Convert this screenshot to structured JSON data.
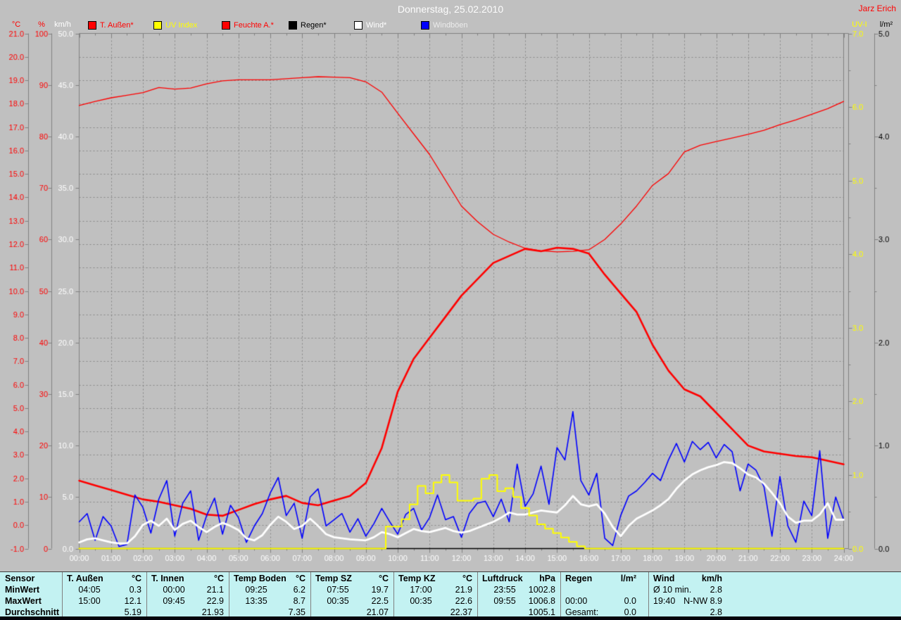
{
  "header": {
    "title": "Donnerstag, 25.02.2010",
    "watermark": "Jarz Erich"
  },
  "colors": {
    "background": "#c0c0c0",
    "grid": "#868686",
    "axis_line": "#808080",
    "title_text": "#fcfcfc",
    "watermark_text": "#ff0000",
    "x_label_text": "#ffffff",
    "table_background": "#c3f2f2",
    "table_text": "#000000",
    "bottom_strip": "#05050d"
  },
  "legend": [
    {
      "label": "T. Außen*",
      "swatch": "#ff0000",
      "text_color": "#ff0000"
    },
    {
      "label": "UV Index",
      "swatch": "#ffff00",
      "text_color": "#ffff00"
    },
    {
      "label": "Feuchte A.*",
      "swatch": "#ff0000",
      "text_color": "#ff0000"
    },
    {
      "label": "Regen*",
      "swatch": "#000000",
      "text_color": "#000000"
    },
    {
      "label": "Wind*",
      "swatch": "#ffffff",
      "text_color": "#ffffff"
    },
    {
      "label": "Windböen",
      "swatch": "#0000ff",
      "text_color": "#ececec"
    }
  ],
  "axes": {
    "left": [
      {
        "id": "degC",
        "header": "°C",
        "color": "#ff0000",
        "min": -1,
        "max": 21,
        "tick_step": 1,
        "decimals": 1
      },
      {
        "id": "pct",
        "header": "%",
        "color": "#ff0000",
        "min": 0,
        "max": 100,
        "tick_step": 10,
        "decimals": 0
      },
      {
        "id": "kmh",
        "header": "km/h",
        "color": "#ffffff",
        "min": 0,
        "max": 50,
        "tick_step": 5,
        "decimals": 1
      }
    ],
    "right": [
      {
        "id": "uvi",
        "header": "UV-I",
        "color": "#ffff00",
        "min": 0,
        "max": 7,
        "tick_step": 1,
        "decimals": 1
      },
      {
        "id": "lm2",
        "header": "l/m²",
        "color": "#000000",
        "min": 0,
        "max": 5,
        "tick_step": 1,
        "decimals": 1
      }
    ],
    "x_labels": [
      "00:00",
      "01:00",
      "02:00",
      "03:00",
      "04:00",
      "05:00",
      "06:00",
      "07:00",
      "08:00",
      "09:00",
      "10:00",
      "11:00",
      "12:00",
      "13:00",
      "14:00",
      "15:00",
      "16:00",
      "17:00",
      "18:00",
      "19:00",
      "20:00",
      "21:00",
      "22:00",
      "23:00",
      "24:00"
    ]
  },
  "chart_data": {
    "type": "line",
    "title": "Donnerstag, 25.02.2010",
    "x_unit": "hours",
    "x_range": [
      0,
      24
    ],
    "grid": "dashed, 1h vertical / 1°C horizontal",
    "legend_position": "top",
    "series": [
      {
        "name": "Feuchte A.*",
        "axis": "pct",
        "color": "#ff0000",
        "width": 1.3,
        "step_min": 30,
        "render": "line",
        "values": [
          86.0,
          86.8,
          87.5,
          88.0,
          88.5,
          89.5,
          89.2,
          89.4,
          90.2,
          90.8,
          91.0,
          91.0,
          91.0,
          91.2,
          91.4,
          91.6,
          91.5,
          91.4,
          90.6,
          88.6,
          84.5,
          80.5,
          76.5,
          71.5,
          66.5,
          63.5,
          61.0,
          59.5,
          58.3,
          57.8,
          57.6,
          57.7,
          58.0,
          60.0,
          63.0,
          66.5,
          70.5,
          72.8,
          77.0,
          78.3,
          79.0,
          79.7,
          80.4,
          81.2,
          82.3,
          83.2,
          84.3,
          85.4,
          86.8
        ]
      },
      {
        "name": "T. Außen*",
        "axis": "degC",
        "color": "#ff0000",
        "width": 2.6,
        "step_min": 30,
        "render": "line",
        "values": [
          1.9,
          1.7,
          1.5,
          1.3,
          1.1,
          1.0,
          0.85,
          0.7,
          0.45,
          0.4,
          0.65,
          0.9,
          1.1,
          1.25,
          0.95,
          0.85,
          1.05,
          1.25,
          1.8,
          3.3,
          5.7,
          7.1,
          8.0,
          8.9,
          9.8,
          10.5,
          11.2,
          11.5,
          11.8,
          11.7,
          11.85,
          11.8,
          11.6,
          10.7,
          9.9,
          9.1,
          7.7,
          6.6,
          5.8,
          5.5,
          4.8,
          4.1,
          3.4,
          3.15,
          3.05,
          2.95,
          2.9,
          2.75,
          2.6
        ]
      },
      {
        "name": "Regen*",
        "axis": "lm2",
        "color": "#000000",
        "width": 1.3,
        "step_min": 720,
        "render": "line",
        "values": [
          0,
          0,
          0
        ]
      },
      {
        "name": "Windböen",
        "axis": "kmh",
        "color": "#0000ff",
        "width": 1.6,
        "step_min": 15,
        "render": "line",
        "values": [
          2.6,
          3.4,
          0.8,
          3.1,
          2.2,
          0.2,
          0.4,
          5.2,
          4.0,
          1.5,
          4.8,
          6.6,
          1.2,
          4.4,
          5.6,
          0.8,
          3.2,
          4.9,
          1.4,
          4.2,
          3.0,
          0.6,
          2.2,
          3.4,
          5.4,
          6.9,
          3.2,
          4.4,
          1.0,
          5.0,
          5.8,
          2.2,
          2.8,
          3.4,
          1.6,
          2.9,
          1.2,
          2.4,
          3.9,
          2.6,
          1.4,
          3.3,
          3.9,
          1.8,
          3.0,
          5.2,
          2.8,
          3.1,
          1.1,
          3.4,
          4.4,
          4.6,
          3.1,
          4.8,
          2.6,
          8.2,
          4.1,
          5.3,
          8.0,
          4.3,
          9.8,
          8.6,
          13.3,
          6.6,
          5.2,
          7.3,
          1.0,
          0.3,
          3.2,
          5.1,
          5.6,
          6.4,
          7.3,
          6.6,
          8.6,
          10.2,
          8.4,
          10.4,
          9.6,
          10.3,
          8.8,
          10.1,
          9.4,
          5.6,
          8.2,
          7.6,
          6.0,
          1.2,
          7.0,
          2.2,
          0.6,
          4.6,
          3.2,
          9.5,
          1.0,
          5.0,
          2.8
        ]
      },
      {
        "name": "Wind*",
        "axis": "kmh",
        "color": "#ffffff",
        "width": 2.8,
        "step_min": 15,
        "render": "line",
        "values": [
          0.6,
          0.9,
          1.0,
          0.8,
          0.6,
          0.5,
          0.5,
          1.2,
          2.3,
          2.7,
          2.2,
          2.9,
          1.8,
          2.4,
          2.7,
          2.1,
          1.6,
          2.1,
          2.5,
          2.2,
          1.8,
          1.0,
          0.8,
          1.3,
          2.3,
          3.1,
          2.6,
          1.9,
          2.2,
          2.9,
          2.2,
          1.4,
          1.1,
          1.0,
          0.9,
          0.85,
          0.8,
          1.1,
          1.6,
          1.4,
          1.1,
          1.5,
          1.9,
          1.7,
          1.6,
          1.8,
          2.0,
          1.7,
          1.55,
          1.7,
          2.0,
          2.3,
          2.6,
          3.0,
          3.5,
          3.3,
          3.3,
          3.5,
          3.7,
          3.6,
          3.5,
          4.2,
          5.1,
          4.3,
          4.1,
          4.3,
          3.4,
          2.1,
          1.2,
          2.2,
          2.9,
          3.3,
          3.7,
          4.2,
          4.8,
          5.8,
          6.6,
          7.2,
          7.6,
          7.9,
          8.1,
          8.4,
          8.3,
          7.8,
          7.2,
          6.9,
          6.3,
          5.4,
          4.4,
          3.1,
          2.5,
          2.7,
          2.7,
          3.3,
          4.4,
          2.8,
          2.8
        ]
      },
      {
        "name": "UV Index",
        "axis": "uvi",
        "color": "#ffff00",
        "width": 2.0,
        "step_min": 15,
        "render": "step",
        "values": [
          0,
          0,
          0,
          0,
          0,
          0,
          0,
          0,
          0,
          0,
          0,
          0,
          0,
          0,
          0,
          0,
          0,
          0,
          0,
          0,
          0,
          0,
          0,
          0,
          0,
          0,
          0,
          0,
          0,
          0,
          0,
          0,
          0,
          0,
          0,
          0,
          0,
          0,
          0,
          0.3,
          0.3,
          0.4,
          0.6,
          0.85,
          0.75,
          0.9,
          1.0,
          0.9,
          0.65,
          0.65,
          0.68,
          0.95,
          1.0,
          0.78,
          0.82,
          0.7,
          0.55,
          0.45,
          0.33,
          0.27,
          0.21,
          0.15,
          0.09,
          0.03,
          0,
          0,
          0,
          0,
          0,
          0,
          0,
          0,
          0,
          0,
          0,
          0,
          0,
          0,
          0,
          0,
          0,
          0,
          0,
          0,
          0,
          0,
          0,
          0,
          0,
          0,
          0,
          0,
          0,
          0,
          0,
          0,
          0
        ]
      }
    ]
  },
  "table": {
    "row_labels": [
      "Sensor",
      "MinWert",
      "MaxWert",
      "Durchschnitt"
    ],
    "groups": [
      {
        "header": "T. Außen",
        "unit": "°C",
        "cells": [
          [
            "04:05",
            "0.3"
          ],
          [
            "15:00",
            "12.1"
          ],
          [
            "",
            "5.19"
          ]
        ]
      },
      {
        "header": "T. Innen",
        "unit": "°C",
        "cells": [
          [
            "00:00",
            "21.1"
          ],
          [
            "09:45",
            "22.9"
          ],
          [
            "",
            "21.93"
          ]
        ]
      },
      {
        "header": "Temp Boden",
        "unit": "°C",
        "cells": [
          [
            "09:25",
            "6.2"
          ],
          [
            "13:35",
            "8.7"
          ],
          [
            "",
            "7.35"
          ]
        ]
      },
      {
        "header": "Temp SZ",
        "unit": "°C",
        "cells": [
          [
            "07:55",
            "19.7"
          ],
          [
            "00:35",
            "22.5"
          ],
          [
            "",
            "21.07"
          ]
        ]
      },
      {
        "header": "Temp KZ",
        "unit": "°C",
        "cells": [
          [
            "17:00",
            "21.9"
          ],
          [
            "00:35",
            "22.6"
          ],
          [
            "",
            "22.37"
          ]
        ]
      },
      {
        "header": "Luftdruck",
        "unit": "hPa",
        "cells": [
          [
            "23:55",
            "1002.8"
          ],
          [
            "09:55",
            "1006.8"
          ],
          [
            "",
            "1005.1"
          ]
        ]
      },
      {
        "header": "Regen",
        "unit": "l/m²",
        "cells": [
          [
            "",
            ""
          ],
          [
            "00:00",
            "0.0"
          ],
          [
            "Gesamt:",
            "0.0"
          ]
        ]
      },
      {
        "header": "Wind",
        "unit": "km/h",
        "cells": [
          [
            "Ø 10 min.",
            "2.8"
          ],
          [
            "19:40",
            "N-NW 8.9"
          ],
          [
            "",
            "2.8"
          ]
        ]
      }
    ]
  }
}
